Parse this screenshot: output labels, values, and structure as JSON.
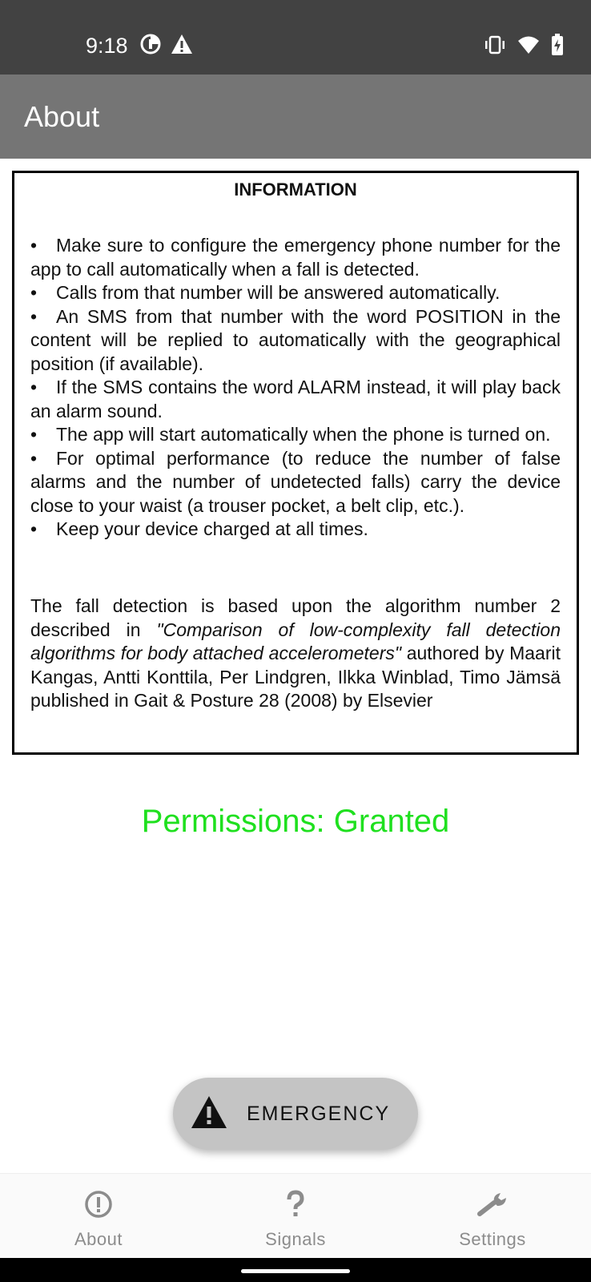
{
  "status_bar": {
    "time": "9:18",
    "left_icons": [
      "data-saver-icon",
      "warning-icon"
    ],
    "right_icons": [
      "vibrate-icon",
      "wifi-icon",
      "battery-charging-icon"
    ]
  },
  "app_bar": {
    "title": "About"
  },
  "info": {
    "heading": "INFORMATION",
    "bullets": [
      "Make sure to configure the emergency phone number for the app to call automatically when a fall is detected.",
      "Calls from that number will be answered automatically.",
      "An SMS from that number with the word POSITION in the content will be replied to automatically with the geographical position (if available).",
      "If the SMS contains the word ALARM instead, it will play back an alarm sound.",
      "The app will start automatically when the phone is turned on.",
      "For optimal performance (to reduce the number of false alarms and the number of undetected falls) carry the device close to your waist (a trouser pocket, a belt clip, etc.).",
      "Keep your device charged at all times."
    ],
    "credit_prefix": "The fall detection is based upon the algorithm number 2 described in ",
    "credit_title": "\"Comparison of low-complexity fall detection algorithms for body attached accelerometers\"",
    "credit_suffix": " authored by Maarit Kangas, Antti Konttila, Per Lindgren, Ilkka Winblad, Timo Jämsä published in Gait & Posture 28 (2008) by Elsevier"
  },
  "permissions": {
    "text": "Permissions: Granted",
    "color": "#1fe01f"
  },
  "emergency_button": {
    "label": "EMERGENCY",
    "icon": "warning-icon"
  },
  "bottom_nav": [
    {
      "label": "About",
      "icon": "info-icon"
    },
    {
      "label": "Signals",
      "icon": "question-icon"
    },
    {
      "label": "Settings",
      "icon": "wrench-icon"
    }
  ]
}
